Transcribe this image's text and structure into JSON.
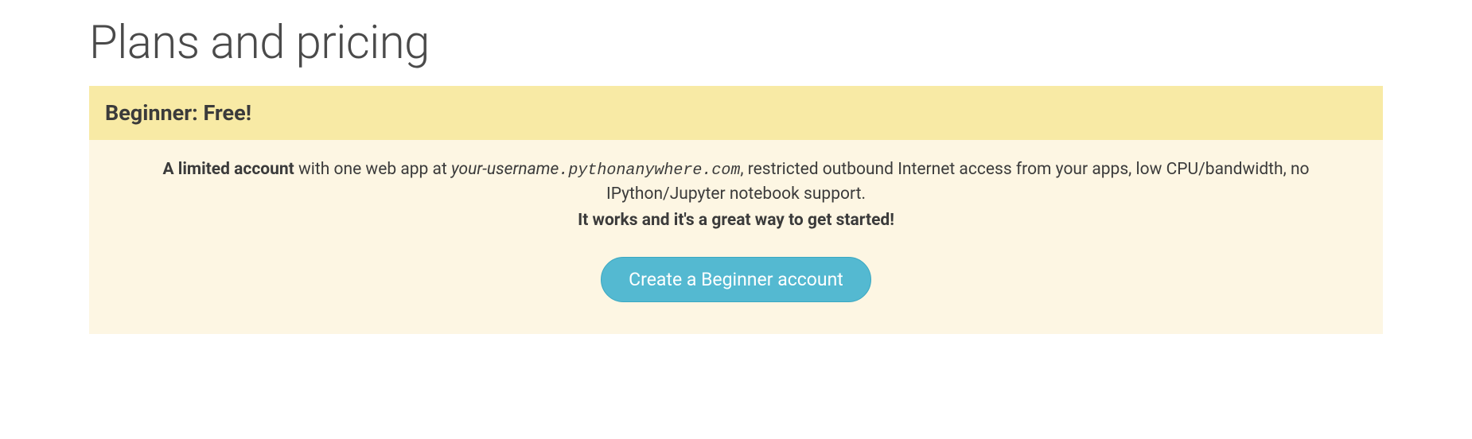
{
  "page": {
    "title": "Plans and pricing"
  },
  "plan": {
    "header": "Beginner: Free!",
    "desc_bold_lead": "A limited account",
    "desc_part1": " with one web app at ",
    "desc_username": "your-username",
    "desc_domain": ".pythonanywhere.com",
    "desc_part2": ", restricted outbound Internet access from your apps, low CPU/bandwidth, no IPython/Jupyter notebook support.",
    "tagline": "It works and it's a great way to get started!",
    "cta_label": "Create a Beginner account"
  }
}
